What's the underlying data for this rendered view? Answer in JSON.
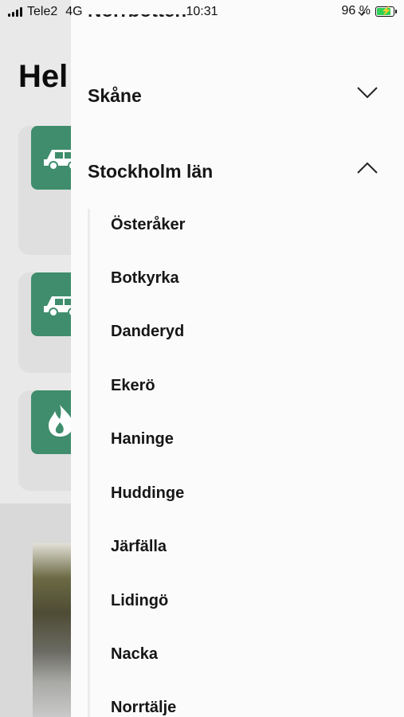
{
  "status_bar": {
    "carrier": "Tele2",
    "network": "4G",
    "time": "10:31",
    "battery_percent": "96 %",
    "battery_level": 0.96,
    "battery_color": "#2fd158"
  },
  "background": {
    "title_partial": "Hel",
    "tiles": [
      {
        "icon": "car-icon"
      },
      {
        "icon": "car-icon"
      },
      {
        "icon": "flame-icon"
      }
    ],
    "accent_color": "#3f8d6c"
  },
  "drawer": {
    "partial_region_label": "Norrbotten",
    "regions": [
      {
        "label": "Skåne",
        "expanded": false,
        "icon": "chevron-down-icon"
      },
      {
        "label": "Stockholm län",
        "expanded": true,
        "icon": "chevron-up-icon"
      }
    ],
    "municipalities": [
      "Österåker",
      "Botkyrka",
      "Danderyd",
      "Ekerö",
      "Haninge",
      "Huddinge",
      "Järfälla",
      "Lidingö",
      "Nacka",
      "Norrtälje"
    ]
  }
}
